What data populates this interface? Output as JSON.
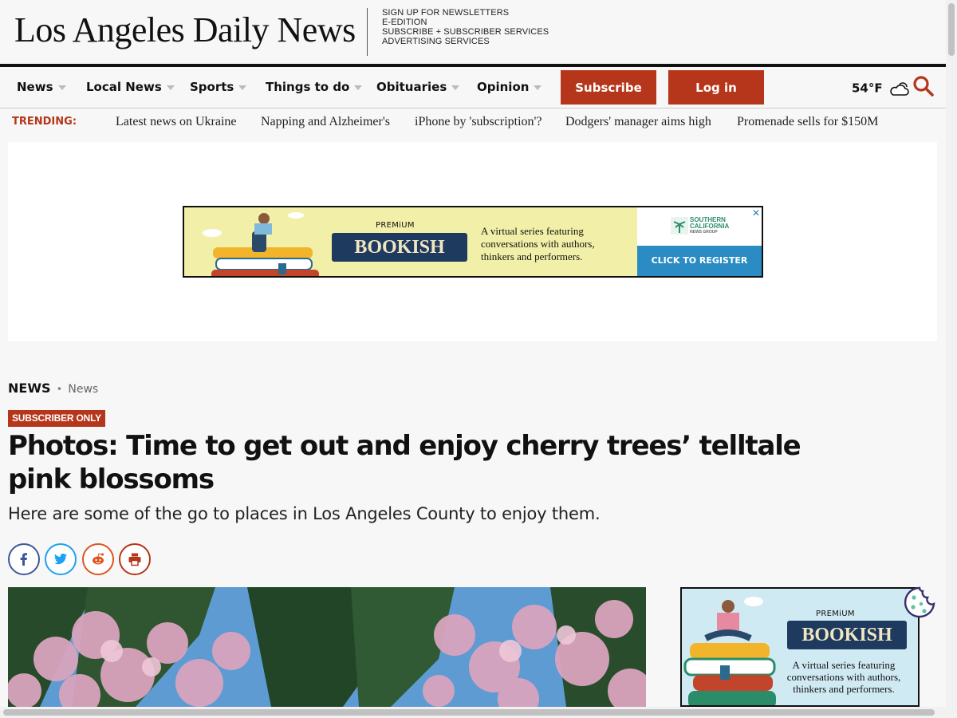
{
  "masthead": {
    "logo": "Los Angeles Daily News",
    "top_links": [
      "SIGN UP FOR NEWSLETTERS",
      "E-EDITION",
      "SUBSCRIBE + SUBSCRIBER SERVICES",
      "ADVERTISING SERVICES"
    ]
  },
  "nav": {
    "items": [
      "News",
      "Local News",
      "Sports",
      "Things to do",
      "Obituaries",
      "Opinion"
    ],
    "subscribe_label": "Subscribe",
    "login_label": "Log in",
    "weather": "54°F",
    "accent_color": "#b5361a"
  },
  "trending": {
    "label": "TRENDING:",
    "links": [
      "Latest news on Ukraine",
      "Napping and Alzheimer's",
      "iPhone by 'subscription'?",
      "Dodgers' manager aims high",
      "Promenade sells for $150M"
    ]
  },
  "ad_banner": {
    "premium": "PREMiUM",
    "title": "BOOKISH",
    "copy": [
      "A virtual series featuring",
      "conversations with authors,",
      "thinkers and performers."
    ],
    "cta": "CLICK TO REGISTER",
    "sponsor": [
      "SOUTHERN",
      "CALIFORNIA",
      "NEWS GROUP"
    ],
    "close": "✕"
  },
  "article": {
    "section": "NEWS",
    "separator": "•",
    "subsection": "News",
    "badge": "SUBSCRIBER ONLY",
    "headline": "Photos: Time to get out and enjoy cherry trees’ telltale pink blossoms",
    "dek": "Here are some of the go to places in Los Angeles County to enjoy them."
  },
  "share": [
    {
      "icon": "facebook-icon",
      "color": "#3b5998"
    },
    {
      "icon": "twitter-icon",
      "color": "#1da1f2"
    },
    {
      "icon": "reddit-icon",
      "color": "#e0531f"
    },
    {
      "icon": "print-icon",
      "color": "#b5361a"
    }
  ],
  "side_ad": {
    "premium": "PREMiUM",
    "title": "BOOKISH",
    "copy": [
      "A virtual series featuring",
      "conversations with authors,",
      "thinkers and performers."
    ]
  }
}
